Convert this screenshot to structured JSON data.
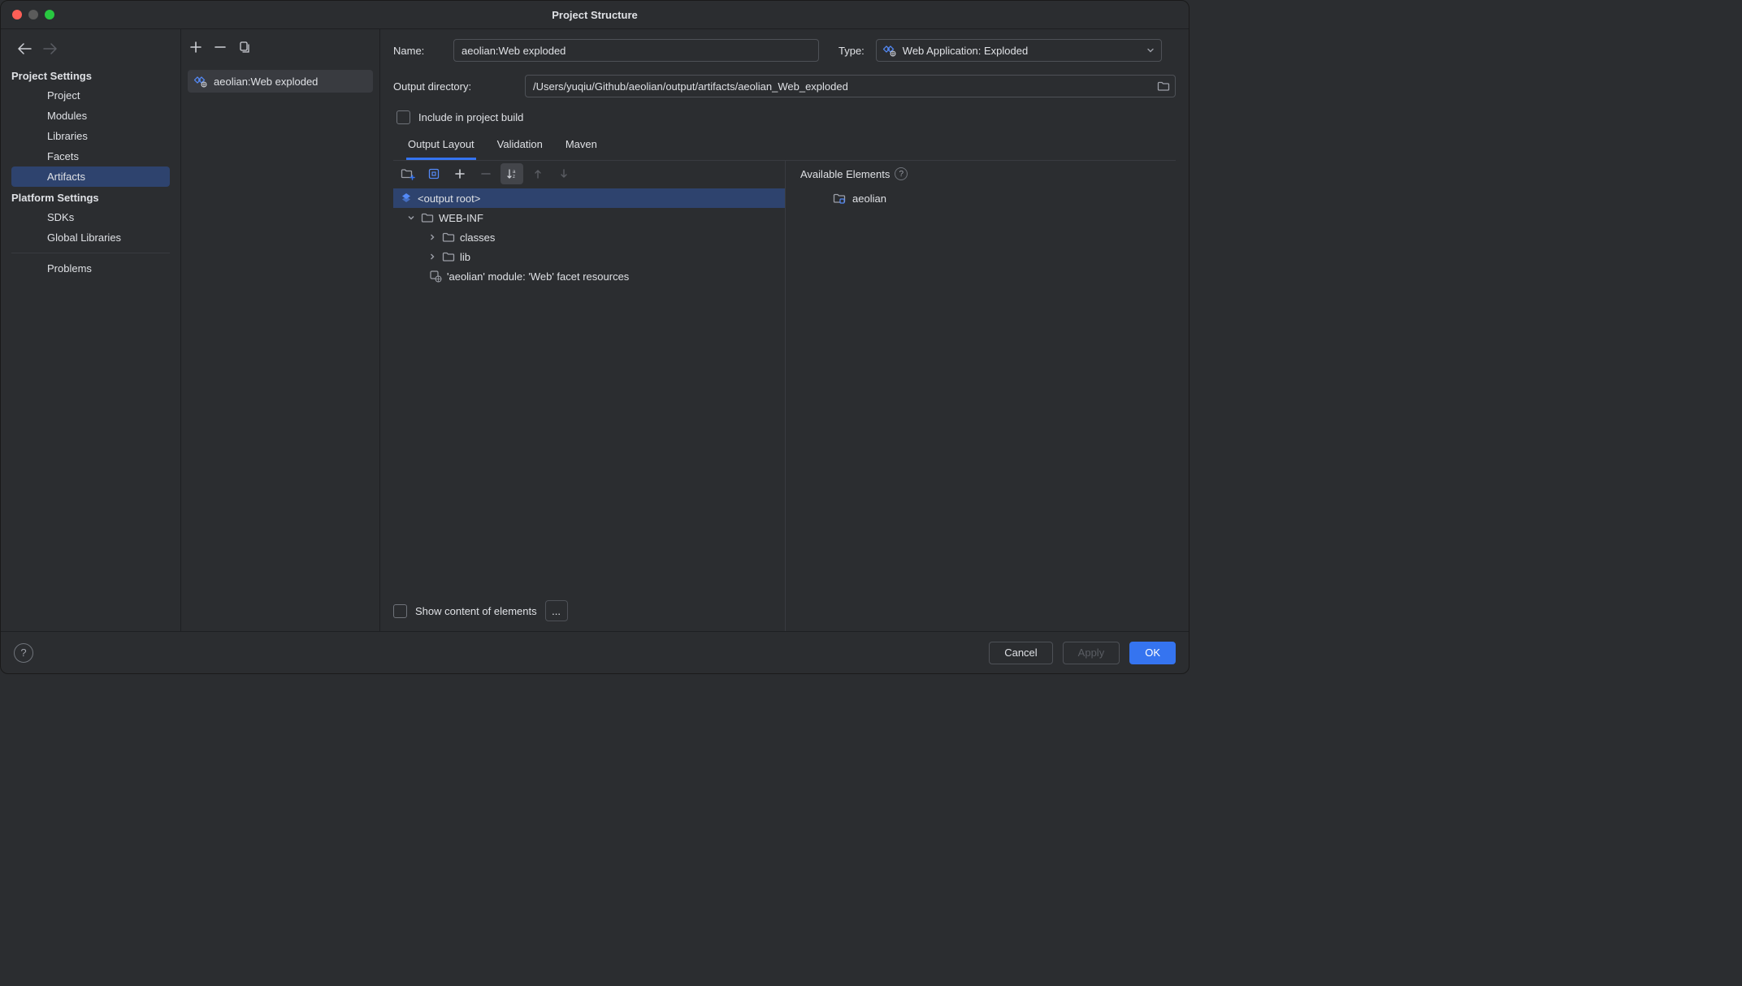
{
  "window": {
    "title": "Project Structure"
  },
  "sidebar": {
    "section1": "Project Settings",
    "items1": [
      "Project",
      "Modules",
      "Libraries",
      "Facets",
      "Artifacts"
    ],
    "selected1": 4,
    "section2": "Platform Settings",
    "items2": [
      "SDKs",
      "Global Libraries"
    ],
    "items3": [
      "Problems"
    ]
  },
  "artifact_list": {
    "items": [
      "aeolian:Web exploded"
    ],
    "selected": 0
  },
  "form": {
    "name_label": "Name:",
    "name_value": "aeolian:Web exploded",
    "type_label": "Type:",
    "type_value": "Web Application: Exploded",
    "outdir_label": "Output directory:",
    "outdir_value": "/Users/yuqiu/Github/aeolian/output/artifacts/aeolian_Web_exploded",
    "include_label": "Include in project build"
  },
  "tabs": {
    "items": [
      "Output Layout",
      "Validation",
      "Maven"
    ],
    "active": 0
  },
  "tree": {
    "root": "<output root>",
    "webinf": "WEB-INF",
    "classes": "classes",
    "lib": "lib",
    "module_web": "'aeolian' module: 'Web' facet resources"
  },
  "available": {
    "header": "Available Elements",
    "items": [
      "aeolian"
    ]
  },
  "bottom": {
    "show_content": "Show content of elements",
    "ellipsis": "..."
  },
  "footer": {
    "cancel": "Cancel",
    "apply": "Apply",
    "ok": "OK"
  }
}
